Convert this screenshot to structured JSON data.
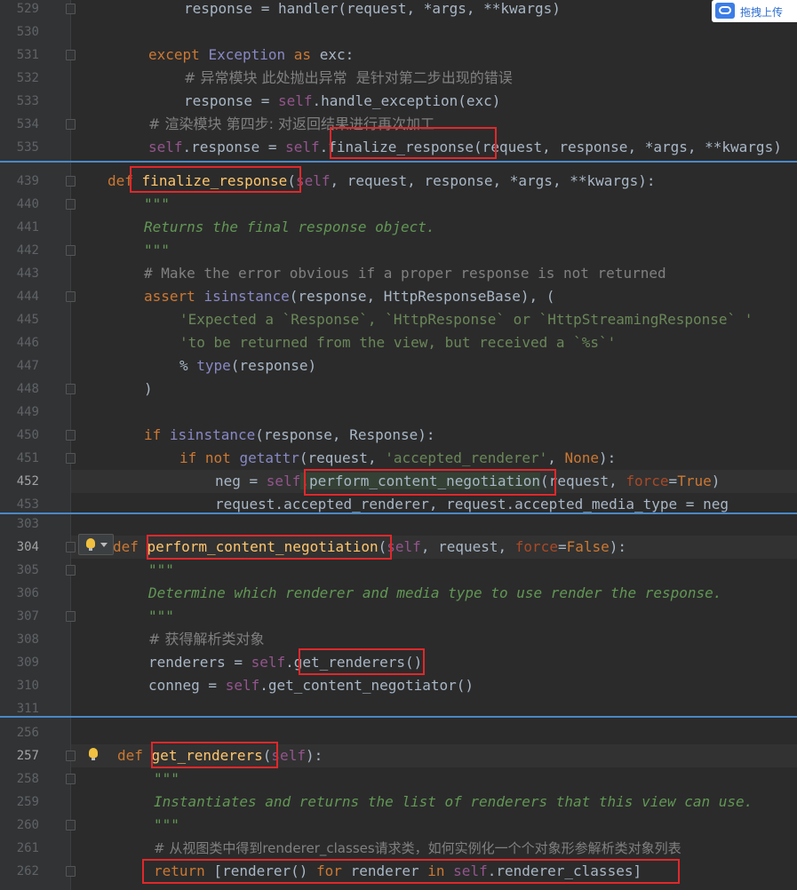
{
  "upload_badge": {
    "label": "拖拽上传",
    "icon": "cloud-upload-icon"
  },
  "panels": [
    {
      "lines": [
        {
          "num": "529",
          "code": "response = handler(request, *args, **kwargs)"
        },
        {
          "num": "530",
          "code": ""
        },
        {
          "num": "531",
          "kw": "except",
          "cls": "Exception",
          "kw2": "as",
          "rest": "exc:"
        },
        {
          "num": "532",
          "code": "# 异常模块 此处抛出异常  是针对第二步出现的错误"
        },
        {
          "num": "533",
          "a": "response = ",
          "self": "self",
          "b": ".handle_exception(exc)"
        },
        {
          "num": "534",
          "code": "# 渲染模块 第四步: 对返回结果进行再次加工."
        },
        {
          "num": "535",
          "self1": "self",
          "a": ".response = ",
          "self2": "self",
          "fn": ".finalize_response",
          "b": "(request, response, *args, **kwargs)"
        }
      ]
    },
    {
      "lines": [
        {
          "num": "439",
          "kw": "def",
          "fn": "finalize_response",
          "self": "self",
          "rest": ", request, response, *args, **kwargs):"
        },
        {
          "num": "440",
          "code": "\"\"\""
        },
        {
          "num": "441",
          "code": "Returns the final response object."
        },
        {
          "num": "442",
          "code": "\"\"\""
        },
        {
          "num": "443",
          "code": "# Make the error obvious if a proper response is not returned"
        },
        {
          "num": "444",
          "kw": "assert",
          "bi": "isinstance",
          "rest": "(response, HttpResponseBase), ("
        },
        {
          "num": "445",
          "code": "'Expected a `Response`, `HttpResponse` or `HttpStreamingResponse` '"
        },
        {
          "num": "446",
          "code": "'to be returned from the view, but received a `%s`'"
        },
        {
          "num": "447",
          "a": "% ",
          "bi": "type",
          "b": "(response)"
        },
        {
          "num": "448",
          "code": ")"
        },
        {
          "num": "449",
          "code": ""
        },
        {
          "num": "450",
          "kw": "if",
          "bi": "isinstance",
          "rest": "(response, Response):"
        },
        {
          "num": "451",
          "kw": "if not",
          "bi": "getattr",
          "a": "(request, ",
          "str": "'accepted_renderer'",
          "b": ", ",
          "kw2": "None",
          "c": "):"
        },
        {
          "num": "452",
          "a": "neg = ",
          "self": "self",
          "fn": ".perform_content_negotiation",
          "b": "(request, ",
          "kwarg": "force",
          "c": "=",
          "kw2": "True",
          "d": ")"
        },
        {
          "num": "453",
          "code": "request.accepted_renderer, request.accepted_media_type = neg"
        }
      ]
    },
    {
      "lines": [
        {
          "num": "303",
          "code": ""
        },
        {
          "num": "304",
          "kw": "def",
          "fn": "perform_content_negotiation",
          "self": "self",
          "a": ", request, ",
          "kwarg": "force",
          "b": "=",
          "kw2": "False",
          "c": "):"
        },
        {
          "num": "305",
          "code": "\"\"\""
        },
        {
          "num": "306",
          "code": "Determine which renderer and media type to use render the response."
        },
        {
          "num": "307",
          "code": "\"\"\""
        },
        {
          "num": "308",
          "code": "# 获得解析类对象"
        },
        {
          "num": "309",
          "a": "renderers = ",
          "self": "self",
          "fn": ".get_renderers",
          "b": "()"
        },
        {
          "num": "310",
          "a": "conneg = ",
          "self": "self",
          "b": ".get_content_negotiator()"
        },
        {
          "num": "311",
          "code": ""
        }
      ]
    },
    {
      "lines": [
        {
          "num": "256",
          "code": ""
        },
        {
          "num": "257",
          "kw": "def",
          "fn": "get_renderers",
          "self": "self",
          "rest": "):"
        },
        {
          "num": "258",
          "code": "\"\"\""
        },
        {
          "num": "259",
          "code": "Instantiates and returns the list of renderers that this view can use."
        },
        {
          "num": "260",
          "code": "\"\"\""
        },
        {
          "num": "261",
          "code": "# 从视图类中得到renderer_classes请求类，如何实例化一个个对象形参解析类对象列表"
        },
        {
          "num": "262",
          "kw": "return",
          "a": " [renderer() ",
          "kw2": "for",
          "b": " renderer ",
          "kw3": "in",
          "c": " ",
          "self": "self",
          "d": ".renderer_classes]"
        }
      ]
    }
  ]
}
